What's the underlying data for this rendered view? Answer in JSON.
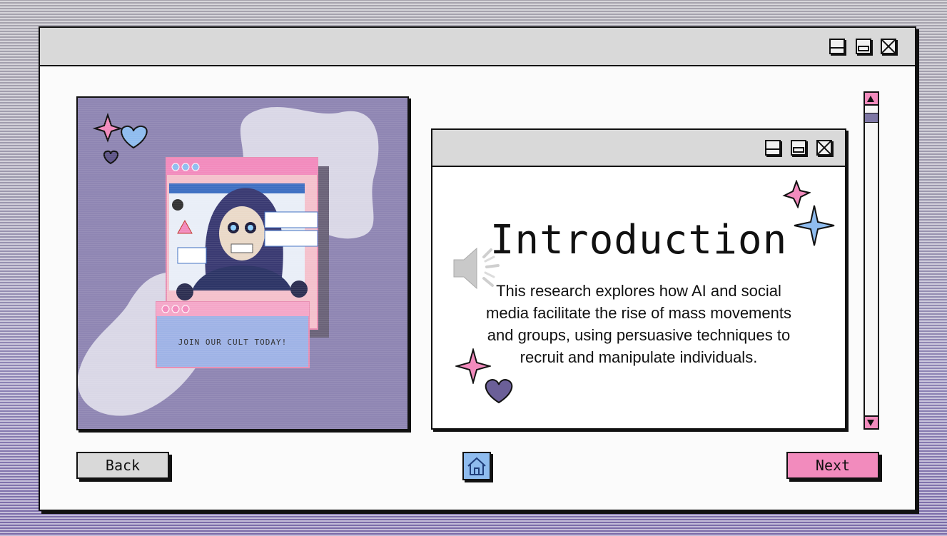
{
  "window": {
    "controls": [
      "minimize",
      "maximize",
      "close"
    ]
  },
  "illustration": {
    "caption": "JOIN OUR CULT TODAY!"
  },
  "content_window": {
    "title": "Introduction",
    "body": "This research explores how AI and social media facilitate the rise of mass movements and groups, using persuasive techniques to recruit and manipulate individuals."
  },
  "nav": {
    "back_label": "Back",
    "next_label": "Next"
  },
  "icons": [
    "minimize-icon",
    "maximize-icon",
    "close-icon",
    "speaker-icon",
    "home-icon",
    "scroll-up-icon",
    "scroll-down-icon",
    "sparkle-icon",
    "heart-icon"
  ],
  "colors": {
    "accent_pink": "#f28bbd",
    "accent_blue": "#8fbcef",
    "accent_purple": "#6b5f98",
    "titlebar": "#d9d9d9"
  }
}
